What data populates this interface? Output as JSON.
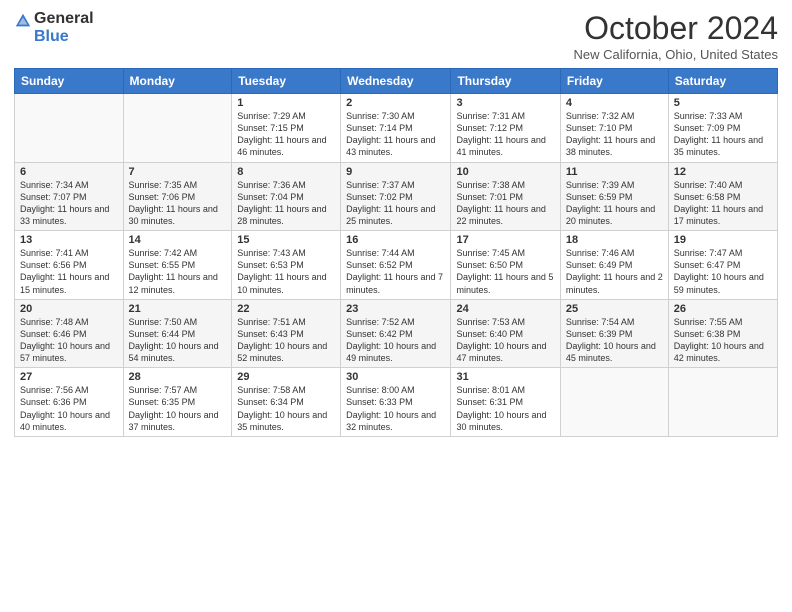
{
  "logo": {
    "general": "General",
    "blue": "Blue"
  },
  "title": "October 2024",
  "subtitle": "New California, Ohio, United States",
  "days_header": [
    "Sunday",
    "Monday",
    "Tuesday",
    "Wednesday",
    "Thursday",
    "Friday",
    "Saturday"
  ],
  "weeks": [
    [
      {
        "num": "",
        "detail": ""
      },
      {
        "num": "",
        "detail": ""
      },
      {
        "num": "1",
        "detail": "Sunrise: 7:29 AM\nSunset: 7:15 PM\nDaylight: 11 hours and 46 minutes."
      },
      {
        "num": "2",
        "detail": "Sunrise: 7:30 AM\nSunset: 7:14 PM\nDaylight: 11 hours and 43 minutes."
      },
      {
        "num": "3",
        "detail": "Sunrise: 7:31 AM\nSunset: 7:12 PM\nDaylight: 11 hours and 41 minutes."
      },
      {
        "num": "4",
        "detail": "Sunrise: 7:32 AM\nSunset: 7:10 PM\nDaylight: 11 hours and 38 minutes."
      },
      {
        "num": "5",
        "detail": "Sunrise: 7:33 AM\nSunset: 7:09 PM\nDaylight: 11 hours and 35 minutes."
      }
    ],
    [
      {
        "num": "6",
        "detail": "Sunrise: 7:34 AM\nSunset: 7:07 PM\nDaylight: 11 hours and 33 minutes."
      },
      {
        "num": "7",
        "detail": "Sunrise: 7:35 AM\nSunset: 7:06 PM\nDaylight: 11 hours and 30 minutes."
      },
      {
        "num": "8",
        "detail": "Sunrise: 7:36 AM\nSunset: 7:04 PM\nDaylight: 11 hours and 28 minutes."
      },
      {
        "num": "9",
        "detail": "Sunrise: 7:37 AM\nSunset: 7:02 PM\nDaylight: 11 hours and 25 minutes."
      },
      {
        "num": "10",
        "detail": "Sunrise: 7:38 AM\nSunset: 7:01 PM\nDaylight: 11 hours and 22 minutes."
      },
      {
        "num": "11",
        "detail": "Sunrise: 7:39 AM\nSunset: 6:59 PM\nDaylight: 11 hours and 20 minutes."
      },
      {
        "num": "12",
        "detail": "Sunrise: 7:40 AM\nSunset: 6:58 PM\nDaylight: 11 hours and 17 minutes."
      }
    ],
    [
      {
        "num": "13",
        "detail": "Sunrise: 7:41 AM\nSunset: 6:56 PM\nDaylight: 11 hours and 15 minutes."
      },
      {
        "num": "14",
        "detail": "Sunrise: 7:42 AM\nSunset: 6:55 PM\nDaylight: 11 hours and 12 minutes."
      },
      {
        "num": "15",
        "detail": "Sunrise: 7:43 AM\nSunset: 6:53 PM\nDaylight: 11 hours and 10 minutes."
      },
      {
        "num": "16",
        "detail": "Sunrise: 7:44 AM\nSunset: 6:52 PM\nDaylight: 11 hours and 7 minutes."
      },
      {
        "num": "17",
        "detail": "Sunrise: 7:45 AM\nSunset: 6:50 PM\nDaylight: 11 hours and 5 minutes."
      },
      {
        "num": "18",
        "detail": "Sunrise: 7:46 AM\nSunset: 6:49 PM\nDaylight: 11 hours and 2 minutes."
      },
      {
        "num": "19",
        "detail": "Sunrise: 7:47 AM\nSunset: 6:47 PM\nDaylight: 10 hours and 59 minutes."
      }
    ],
    [
      {
        "num": "20",
        "detail": "Sunrise: 7:48 AM\nSunset: 6:46 PM\nDaylight: 10 hours and 57 minutes."
      },
      {
        "num": "21",
        "detail": "Sunrise: 7:50 AM\nSunset: 6:44 PM\nDaylight: 10 hours and 54 minutes."
      },
      {
        "num": "22",
        "detail": "Sunrise: 7:51 AM\nSunset: 6:43 PM\nDaylight: 10 hours and 52 minutes."
      },
      {
        "num": "23",
        "detail": "Sunrise: 7:52 AM\nSunset: 6:42 PM\nDaylight: 10 hours and 49 minutes."
      },
      {
        "num": "24",
        "detail": "Sunrise: 7:53 AM\nSunset: 6:40 PM\nDaylight: 10 hours and 47 minutes."
      },
      {
        "num": "25",
        "detail": "Sunrise: 7:54 AM\nSunset: 6:39 PM\nDaylight: 10 hours and 45 minutes."
      },
      {
        "num": "26",
        "detail": "Sunrise: 7:55 AM\nSunset: 6:38 PM\nDaylight: 10 hours and 42 minutes."
      }
    ],
    [
      {
        "num": "27",
        "detail": "Sunrise: 7:56 AM\nSunset: 6:36 PM\nDaylight: 10 hours and 40 minutes."
      },
      {
        "num": "28",
        "detail": "Sunrise: 7:57 AM\nSunset: 6:35 PM\nDaylight: 10 hours and 37 minutes."
      },
      {
        "num": "29",
        "detail": "Sunrise: 7:58 AM\nSunset: 6:34 PM\nDaylight: 10 hours and 35 minutes."
      },
      {
        "num": "30",
        "detail": "Sunrise: 8:00 AM\nSunset: 6:33 PM\nDaylight: 10 hours and 32 minutes."
      },
      {
        "num": "31",
        "detail": "Sunrise: 8:01 AM\nSunset: 6:31 PM\nDaylight: 10 hours and 30 minutes."
      },
      {
        "num": "",
        "detail": ""
      },
      {
        "num": "",
        "detail": ""
      }
    ]
  ]
}
